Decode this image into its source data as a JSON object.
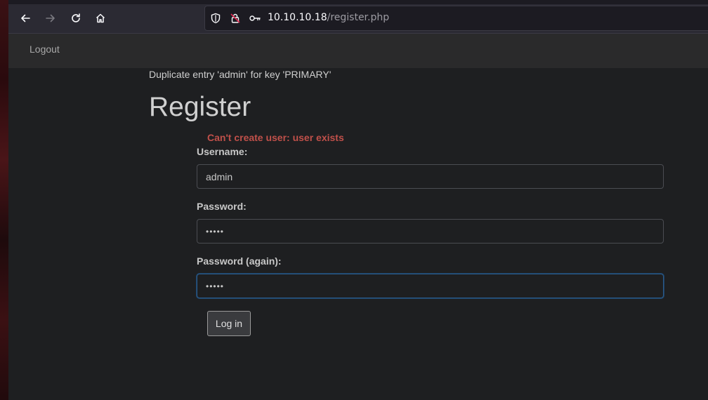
{
  "browser": {
    "url_host": "10.10.10.18",
    "url_path": "/register.php",
    "icons": [
      "back-arrow-icon",
      "forward-arrow-icon",
      "reload-icon",
      "home-icon",
      "shield-icon",
      "insecure-lock-icon",
      "key-icon"
    ]
  },
  "navbar": {
    "logout_label": "Logout"
  },
  "page": {
    "sql_error": "Duplicate entry 'admin' for key 'PRIMARY'",
    "title": "Register",
    "error_message": "Can't create user: user exists"
  },
  "form": {
    "username_label": "Username:",
    "username_value": "admin",
    "password_label": "Password:",
    "password_value": "•••••",
    "password_again_label": "Password (again):",
    "password_again_value": "•••••",
    "submit_label": "Log in"
  },
  "colors": {
    "error": "#c0504a",
    "background": "#1e1f21",
    "navbar": "#2a2a2b",
    "focus_border": "#2a5a8a"
  }
}
